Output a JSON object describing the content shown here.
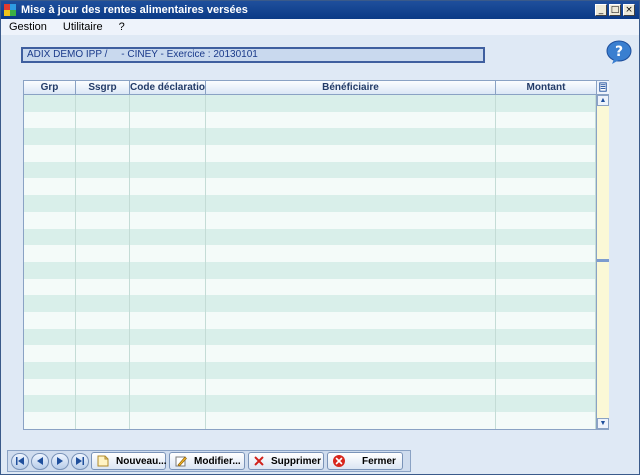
{
  "window": {
    "title": "Mise à jour  des rentes alimentaires versées",
    "controls": {
      "minimize": "_",
      "maximize": "□",
      "close": "×"
    }
  },
  "menu": {
    "items": [
      {
        "label": "Gestion"
      },
      {
        "label": "Utilitaire"
      },
      {
        "label": "?"
      }
    ]
  },
  "info": {
    "text": "ADIX DEMO IPP /     - CINEY - Exercice : 20130101"
  },
  "grid": {
    "columns": [
      "Grp",
      "Ssgrp",
      "Code déclaration",
      "Bénéficiaire",
      "Montant"
    ],
    "row_count": 20,
    "rows": []
  },
  "toolbar": {
    "nav": [
      "first-record-icon",
      "previous-record-icon",
      "next-record-icon",
      "last-record-icon"
    ],
    "nouveau_label": "Nouveau...",
    "modifier_label": "Modifier...",
    "supprimer_label": "Supprimer",
    "fermer_label": "Fermer"
  },
  "colors": {
    "title_bar": "#0a3a86",
    "row_odd": "#d9efea",
    "row_even": "#f4fbf9",
    "info_text": "#1a3a8a"
  }
}
